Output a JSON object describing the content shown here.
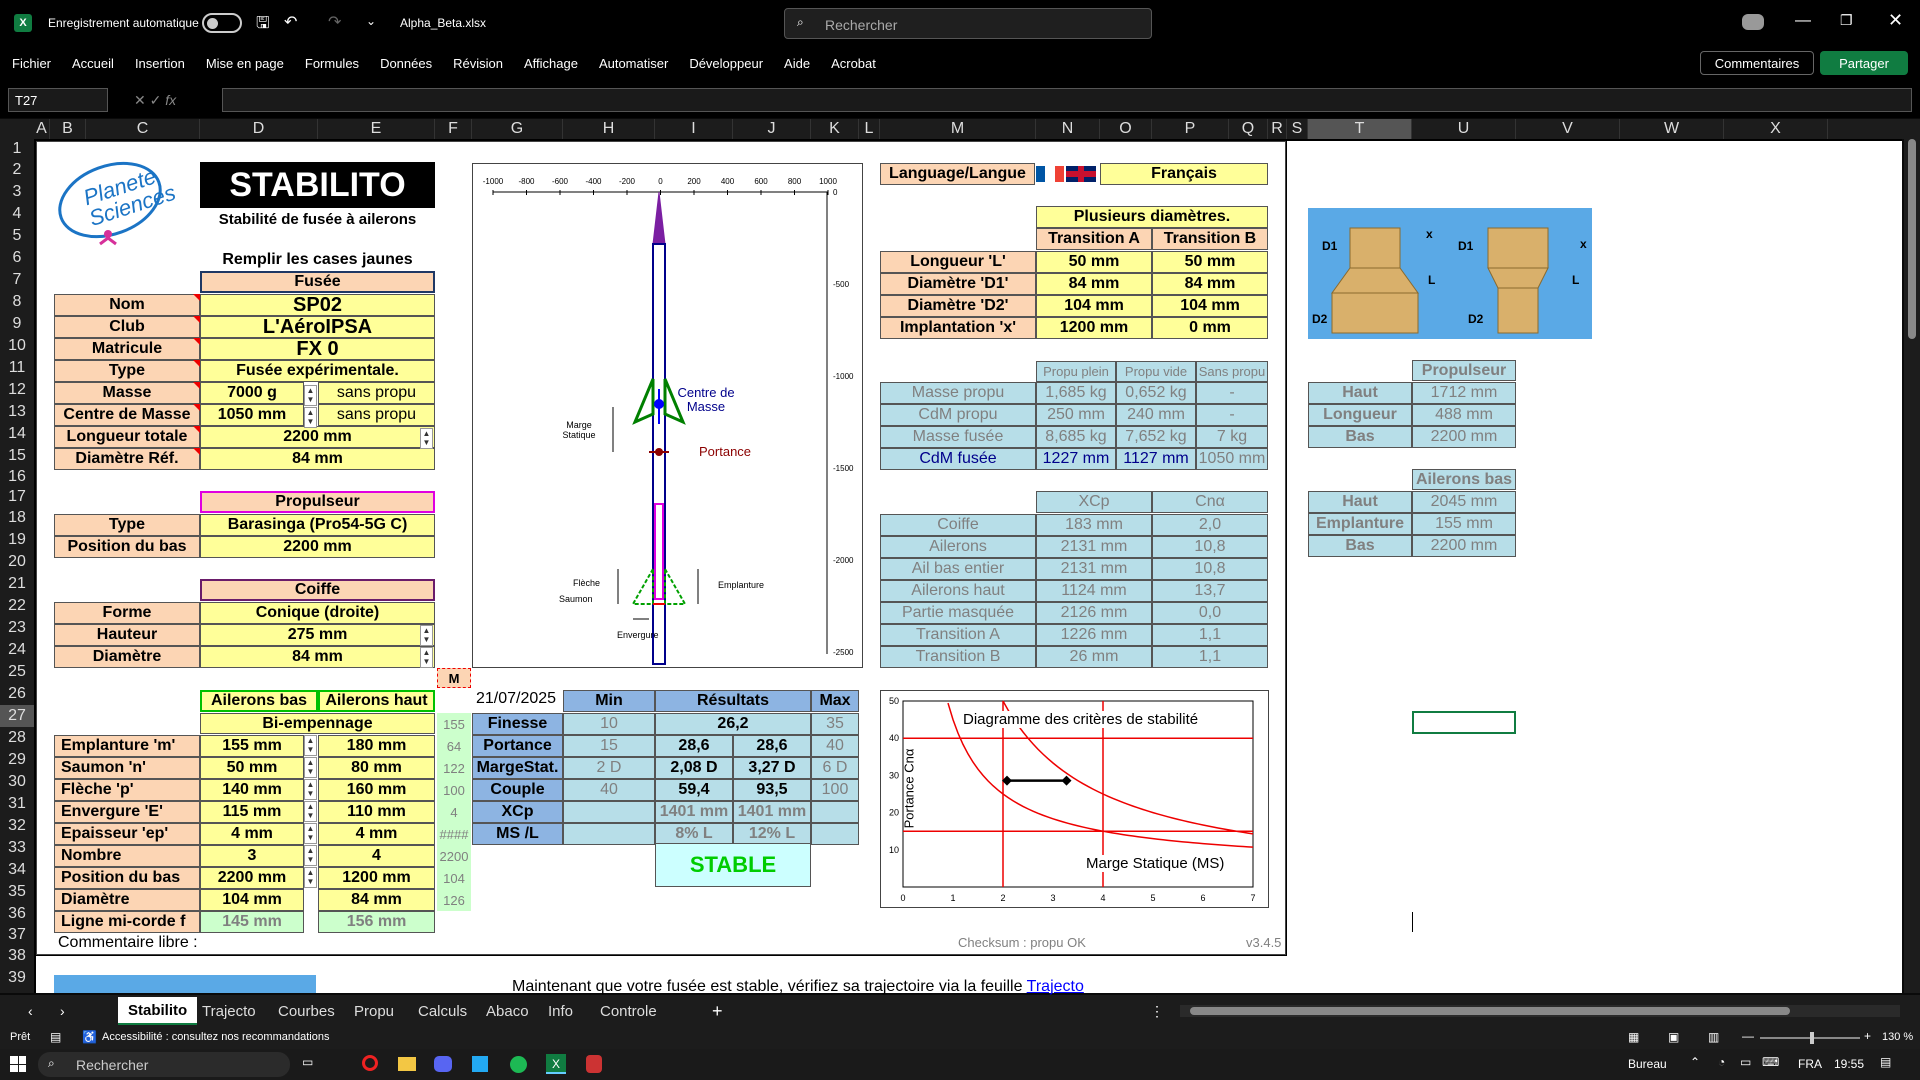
{
  "titlebar": {
    "autosave": "Enregistrement automatique",
    "filename": "Alpha_Beta.xlsx",
    "search": "Rechercher"
  },
  "menu": [
    "Fichier",
    "Accueil",
    "Insertion",
    "Mise en page",
    "Formules",
    "Données",
    "Révision",
    "Affichage",
    "Automatiser",
    "Développeur",
    "Aide",
    "Acrobat"
  ],
  "comments": "Commentaires",
  "share": "Partager",
  "namebox": "T27",
  "columns": [
    "A",
    "B",
    "C",
    "D",
    "E",
    "F",
    "G",
    "H",
    "I",
    "J",
    "K",
    "L",
    "M",
    "N",
    "O",
    "P",
    "Q",
    "R",
    "S",
    "T",
    "U",
    "V",
    "W",
    "X"
  ],
  "rows": [
    "1",
    "2",
    "3",
    "4",
    "5",
    "6",
    "7",
    "8",
    "9",
    "10",
    "11",
    "12",
    "13",
    "14",
    "15",
    "16",
    "17",
    "18",
    "19",
    "20",
    "21",
    "22",
    "23",
    "24",
    "25",
    "26",
    "27",
    "28",
    "29",
    "30",
    "31",
    "32",
    "33",
    "34",
    "35",
    "36",
    "37",
    "38",
    "39"
  ],
  "sheet": {
    "logo": "Planète Sciences",
    "title": "STABILITO",
    "subtitle": "Stabilité de fusée à ailerons",
    "fill_hint": "Remplir les cases jaunes",
    "fusee": {
      "header": "Fusée",
      "rows": [
        [
          "Nom",
          "SP02",
          ""
        ],
        [
          "Club",
          "L'AéroIPSA",
          ""
        ],
        [
          "Matricule",
          "FX 0",
          ""
        ],
        [
          "Type",
          "Fusée expérimentale.",
          ""
        ],
        [
          "Masse",
          "7000 g",
          "sans propu"
        ],
        [
          "Centre de Masse",
          "1050 mm",
          "sans propu"
        ],
        [
          "Longueur totale",
          "2200 mm",
          ""
        ],
        [
          "Diamètre Réf.",
          "84 mm",
          ""
        ]
      ]
    },
    "propulseur": {
      "header": "Propulseur",
      "rows": [
        [
          "Type",
          "Barasinga (Pro54-5G C)"
        ],
        [
          "Position du bas",
          "2200 mm"
        ]
      ]
    },
    "coiffe": {
      "header": "Coiffe",
      "rows": [
        [
          "Forme",
          "Conique (droite)"
        ],
        [
          "Hauteur",
          "275 mm"
        ],
        [
          "Diamètre",
          "84 mm"
        ]
      ]
    },
    "m_btn": "M",
    "ailerons": {
      "h1": "Ailerons bas",
      "h2": "Ailerons haut",
      "type": "Bi-empennage",
      "rows": [
        [
          "Emplanture  'm'",
          "155 mm",
          "180 mm",
          "155"
        ],
        [
          "Saumon    'n'",
          "50 mm",
          "80 mm",
          "64"
        ],
        [
          "Flèche     'p'",
          "140 mm",
          "160 mm",
          "122"
        ],
        [
          "Envergure    'E'",
          "115 mm",
          "110 mm",
          "100"
        ],
        [
          "Epaisseur    'ep'",
          "4 mm",
          "4 mm",
          "4"
        ],
        [
          "Nombre",
          "3",
          "4",
          "####"
        ],
        [
          "Position du bas",
          "2200 mm",
          "1200 mm",
          "2200"
        ],
        [
          "Diamètre",
          "104 mm",
          "84 mm",
          "104"
        ],
        [
          "Ligne mi-corde f",
          "145 mm",
          "156 mm",
          "126"
        ]
      ]
    },
    "comment": "Commentaire libre :",
    "rocket_axis": [
      "-1000",
      "-800",
      "-600",
      "-400",
      "-200",
      "0",
      "200",
      "400",
      "600",
      "800",
      "1000"
    ],
    "rocket_yaxis": [
      "0",
      "-500",
      "-1000",
      "-1500",
      "-2000",
      "-2500"
    ],
    "rocket_labels": {
      "cdm": "Centre de Masse",
      "portance": "Portance",
      "marge": "Marge Statique",
      "fleche": "Flèche",
      "saumon": "Saumon",
      "emplanture": "Emplanture",
      "envergure": "Envergure"
    },
    "language": {
      "label": "Language/Langue",
      "value": "Français"
    },
    "diam": {
      "header": "Plusieurs diamètres.",
      "colA": "Transition A",
      "colB": "Transition B",
      "rows": [
        [
          "Longueur     'L'",
          "50 mm",
          "50 mm"
        ],
        [
          "Diamètre    'D1'",
          "84 mm",
          "84 mm"
        ],
        [
          "Diamètre    'D2'",
          "104 mm",
          "104 mm"
        ],
        [
          "Implantation 'x'",
          "1200 mm",
          "0 mm"
        ]
      ]
    },
    "propu_tbl": {
      "cols": [
        "Propu plein",
        "Propu vide",
        "Sans propu"
      ],
      "rows": [
        [
          "Masse propu",
          "1,685 kg",
          "0,652 kg",
          "-"
        ],
        [
          "CdM propu",
          "250 mm",
          "240 mm",
          "-"
        ],
        [
          "Masse fusée",
          "8,685 kg",
          "7,652 kg",
          "7 kg"
        ],
        [
          "CdM fusée",
          "1227 mm",
          "1127 mm",
          "1050 mm"
        ]
      ]
    },
    "xcp_tbl": {
      "cols": [
        "XCp",
        "Cnα"
      ],
      "rows": [
        [
          "Coiffe",
          "183 mm",
          "2,0"
        ],
        [
          "Ailerons",
          "2131 mm",
          "10,8"
        ],
        [
          "Ail bas entier",
          "2131 mm",
          "10,8"
        ],
        [
          "Ailerons haut",
          "1124 mm",
          "13,7"
        ],
        [
          "Partie masquée",
          "2126 mm",
          "0,0"
        ],
        [
          "Transition A",
          "1226 mm",
          "1,1"
        ],
        [
          "Transition B",
          "26 mm",
          "1,1"
        ]
      ]
    },
    "right_propu": {
      "header": "Propulseur",
      "rows": [
        [
          "Haut",
          "1712 mm"
        ],
        [
          "Longueur",
          "488 mm"
        ],
        [
          "Bas",
          "2200 mm"
        ]
      ]
    },
    "right_ail": {
      "header": "Ailerons bas",
      "rows": [
        [
          "Haut",
          "2045 mm"
        ],
        [
          "Emplanture",
          "155 mm"
        ],
        [
          "Bas",
          "2200 mm"
        ]
      ]
    },
    "date": "21/07/2025",
    "results": {
      "hmin": "Min",
      "hres": "Résultats",
      "hmax": "Max",
      "rows": [
        [
          "Finesse",
          "10",
          "26,2",
          "",
          "35"
        ],
        [
          "Portance",
          "15",
          "28,6",
          "28,6",
          "40"
        ],
        [
          "MargeStat.",
          "2 D",
          "2,08 D",
          "3,27 D",
          "6 D"
        ],
        [
          "Couple",
          "40",
          "59,4",
          "93,5",
          "100"
        ],
        [
          "XCp",
          "",
          "1401 mm",
          "1401 mm",
          ""
        ],
        [
          "MS /L",
          "",
          "8% L",
          "12% L",
          ""
        ]
      ],
      "stable": "STABLE"
    },
    "chart_title": "Diagramme des critères de stabilité",
    "chart_x": "Marge Statique (MS)",
    "chart_y": "Portance Cnα",
    "checksum": "Checksum : propu OK",
    "version": "v3.4.5",
    "footer_text": "Maintenant que votre fusée est stable, vérifiez sa trajectoire via la feuille",
    "footer_link": "Trajecto"
  },
  "chart_data": {
    "type": "line",
    "title": "Diagramme des critères de stabilité",
    "xlabel": "Marge Statique (MS)",
    "ylabel": "Portance Cnα",
    "xlim": [
      0,
      7
    ],
    "ylim": [
      0,
      50
    ],
    "x_ticks": [
      "0",
      "1",
      "2",
      "3",
      "4",
      "5",
      "6",
      "7"
    ],
    "y_ticks": [
      "10",
      "20",
      "30",
      "40",
      "50"
    ],
    "series": [
      {
        "x": [
          2.08,
          3.27
        ],
        "values": [
          28.6,
          28.6
        ]
      }
    ]
  },
  "tabs": [
    "Stabilito",
    "Trajecto",
    "Courbes",
    "Propu",
    "Calculs",
    "Abaco",
    "Info",
    "Controle"
  ],
  "status": {
    "ready": "Prêt",
    "access": "Accessibilité : consultez nos recommandations",
    "zoom": "130 %"
  },
  "taskbar": {
    "search": "Rechercher",
    "bureau": "Bureau",
    "lang": "FRA",
    "time": "19:55"
  }
}
